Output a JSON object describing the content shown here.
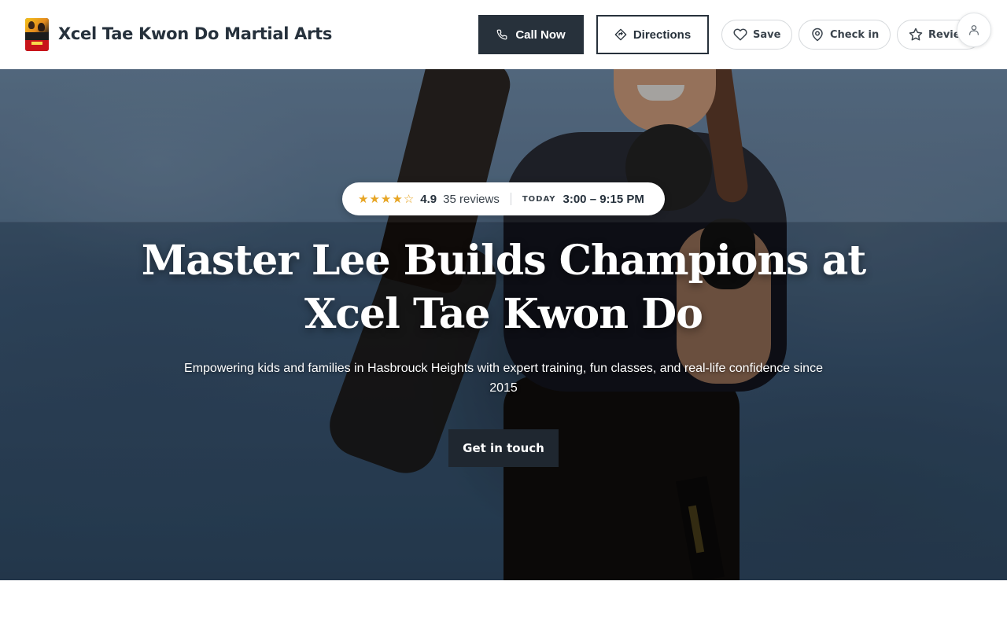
{
  "header": {
    "business_name": "Xcel Tae Kwon Do Martial Arts",
    "call_label": "Call Now",
    "directions_label": "Directions",
    "save_label": "Save",
    "checkin_label": "Check in",
    "review_label": "Review"
  },
  "hero": {
    "rating": "4.9",
    "rating_value": 4.5,
    "rating_max": 5,
    "reviews_count": "35",
    "reviews_label": "reviews",
    "today_label": "TODAY",
    "hours": "3:00 – 9:15 PM",
    "headline_line1": "Master Lee Builds Champions at",
    "headline_line2": "Xcel Tae Kwon Do",
    "subheadline": "Empowering kids and families in Hasbrouck Heights with expert training, fun classes, and real-life confidence since 2015",
    "cta_label": "Get in touch"
  },
  "icons": {
    "phone": "phone-icon",
    "directions": "directions-icon",
    "save": "heart-icon",
    "checkin": "map-pin-icon",
    "review": "star-outline-icon",
    "account": "user-icon"
  },
  "colors": {
    "primary_dark": "#27313b",
    "star": "#e7a524",
    "text": "#26313c"
  }
}
